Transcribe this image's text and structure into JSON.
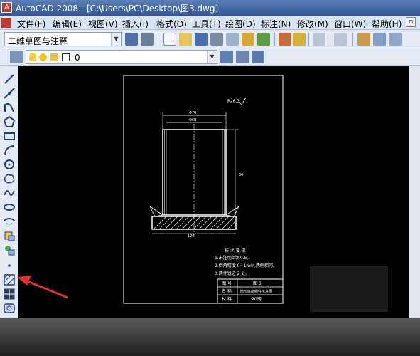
{
  "window": {
    "title": "AutoCAD 2008 - [C:\\Users\\PC\\Desktop\\图3.dwg]"
  },
  "menu": [
    "文件(F)",
    "编辑(E)",
    "视图(V)",
    "插入(I)",
    "格式(O)",
    "工具(T)",
    "绘图(D)",
    "标注(N)",
    "修改(M)",
    "窗口(W)",
    "帮助(H)"
  ],
  "toolbar": {
    "workspace_combo": "二维草图与注释",
    "layer_combo": "0"
  },
  "left_tools": [
    "line-icon",
    "construction-line-icon",
    "polyline-icon",
    "polygon-icon",
    "rectangle-icon",
    "arc-icon",
    "circle-icon",
    "revision-cloud-icon",
    "spline-icon",
    "ellipse-icon",
    "ellipse-arc-icon",
    "insert-block-icon",
    "make-block-icon",
    "point-icon",
    "hatch-icon",
    "gradient-icon",
    "region-icon"
  ],
  "drawing": {
    "note_title": "技 术 要 求",
    "notes": [
      "1.未注明倒角0.5。",
      "2.倒角精度 0~1mm,两侧相同。",
      "3.两件锐边 2 处。"
    ],
    "title_block": [
      [
        "图 号",
        "图 3"
      ],
      [
        "名 称",
        "筒形底座组件示意图"
      ],
      [
        "材 料",
        "20钢"
      ]
    ],
    "dims": {
      "top_outer": "Φ70",
      "top_inner": "Φ60",
      "height": "80",
      "base_width": "120",
      "roughness": "Ra6.3"
    }
  },
  "colors": {
    "title_bar": "#2f5597",
    "canvas_bg": "#000000",
    "annotation_arrow": "#e0332f"
  }
}
